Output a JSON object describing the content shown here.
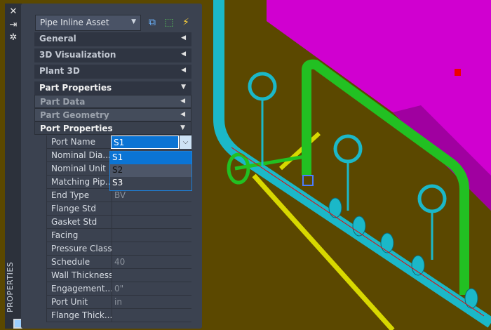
{
  "palette": {
    "accent": "#0b74d4",
    "background": "#5b4800",
    "panel": "#3b4250"
  },
  "strip": {
    "title": "PROPERTIES",
    "icons": [
      "close-icon",
      "auto-hide-icon",
      "settings-icon"
    ]
  },
  "selector": {
    "value": "Pipe Inline Asset"
  },
  "toolbar": {
    "icons": [
      "toggle-pickadd-icon",
      "select-objects-icon",
      "quick-select-icon"
    ]
  },
  "sections": [
    {
      "label": "General",
      "expanded": false
    },
    {
      "label": "3D Visualization",
      "expanded": false
    },
    {
      "label": "Plant 3D",
      "expanded": false
    },
    {
      "label": "Part Properties",
      "expanded": true
    }
  ],
  "subsections": [
    {
      "label": "Part Data",
      "expanded": false
    },
    {
      "label": "Part Geometry",
      "expanded": false
    },
    {
      "label": "Port Properties",
      "expanded": true
    }
  ],
  "port_name": {
    "label": "Port Name",
    "value": "S1",
    "options": [
      "S1",
      "S2",
      "S3"
    ]
  },
  "rows": [
    {
      "label": "Nominal  Dia...",
      "value": ""
    },
    {
      "label": "Nominal Unit",
      "value": ""
    },
    {
      "label": "Matching Pip...",
      "value": ""
    },
    {
      "label": "End Type",
      "value": "BV"
    },
    {
      "label": "Flange Std",
      "value": ""
    },
    {
      "label": "Gasket Std",
      "value": ""
    },
    {
      "label": "Facing",
      "value": ""
    },
    {
      "label": "Pressure Class",
      "value": ""
    },
    {
      "label": "Schedule",
      "value": "40"
    },
    {
      "label": "Wall Thickness",
      "value": ""
    },
    {
      "label": "Engagement...",
      "value": "0\""
    },
    {
      "label": "Port Unit",
      "value": "in"
    },
    {
      "label": "Flange Thick...",
      "value": ""
    }
  ]
}
